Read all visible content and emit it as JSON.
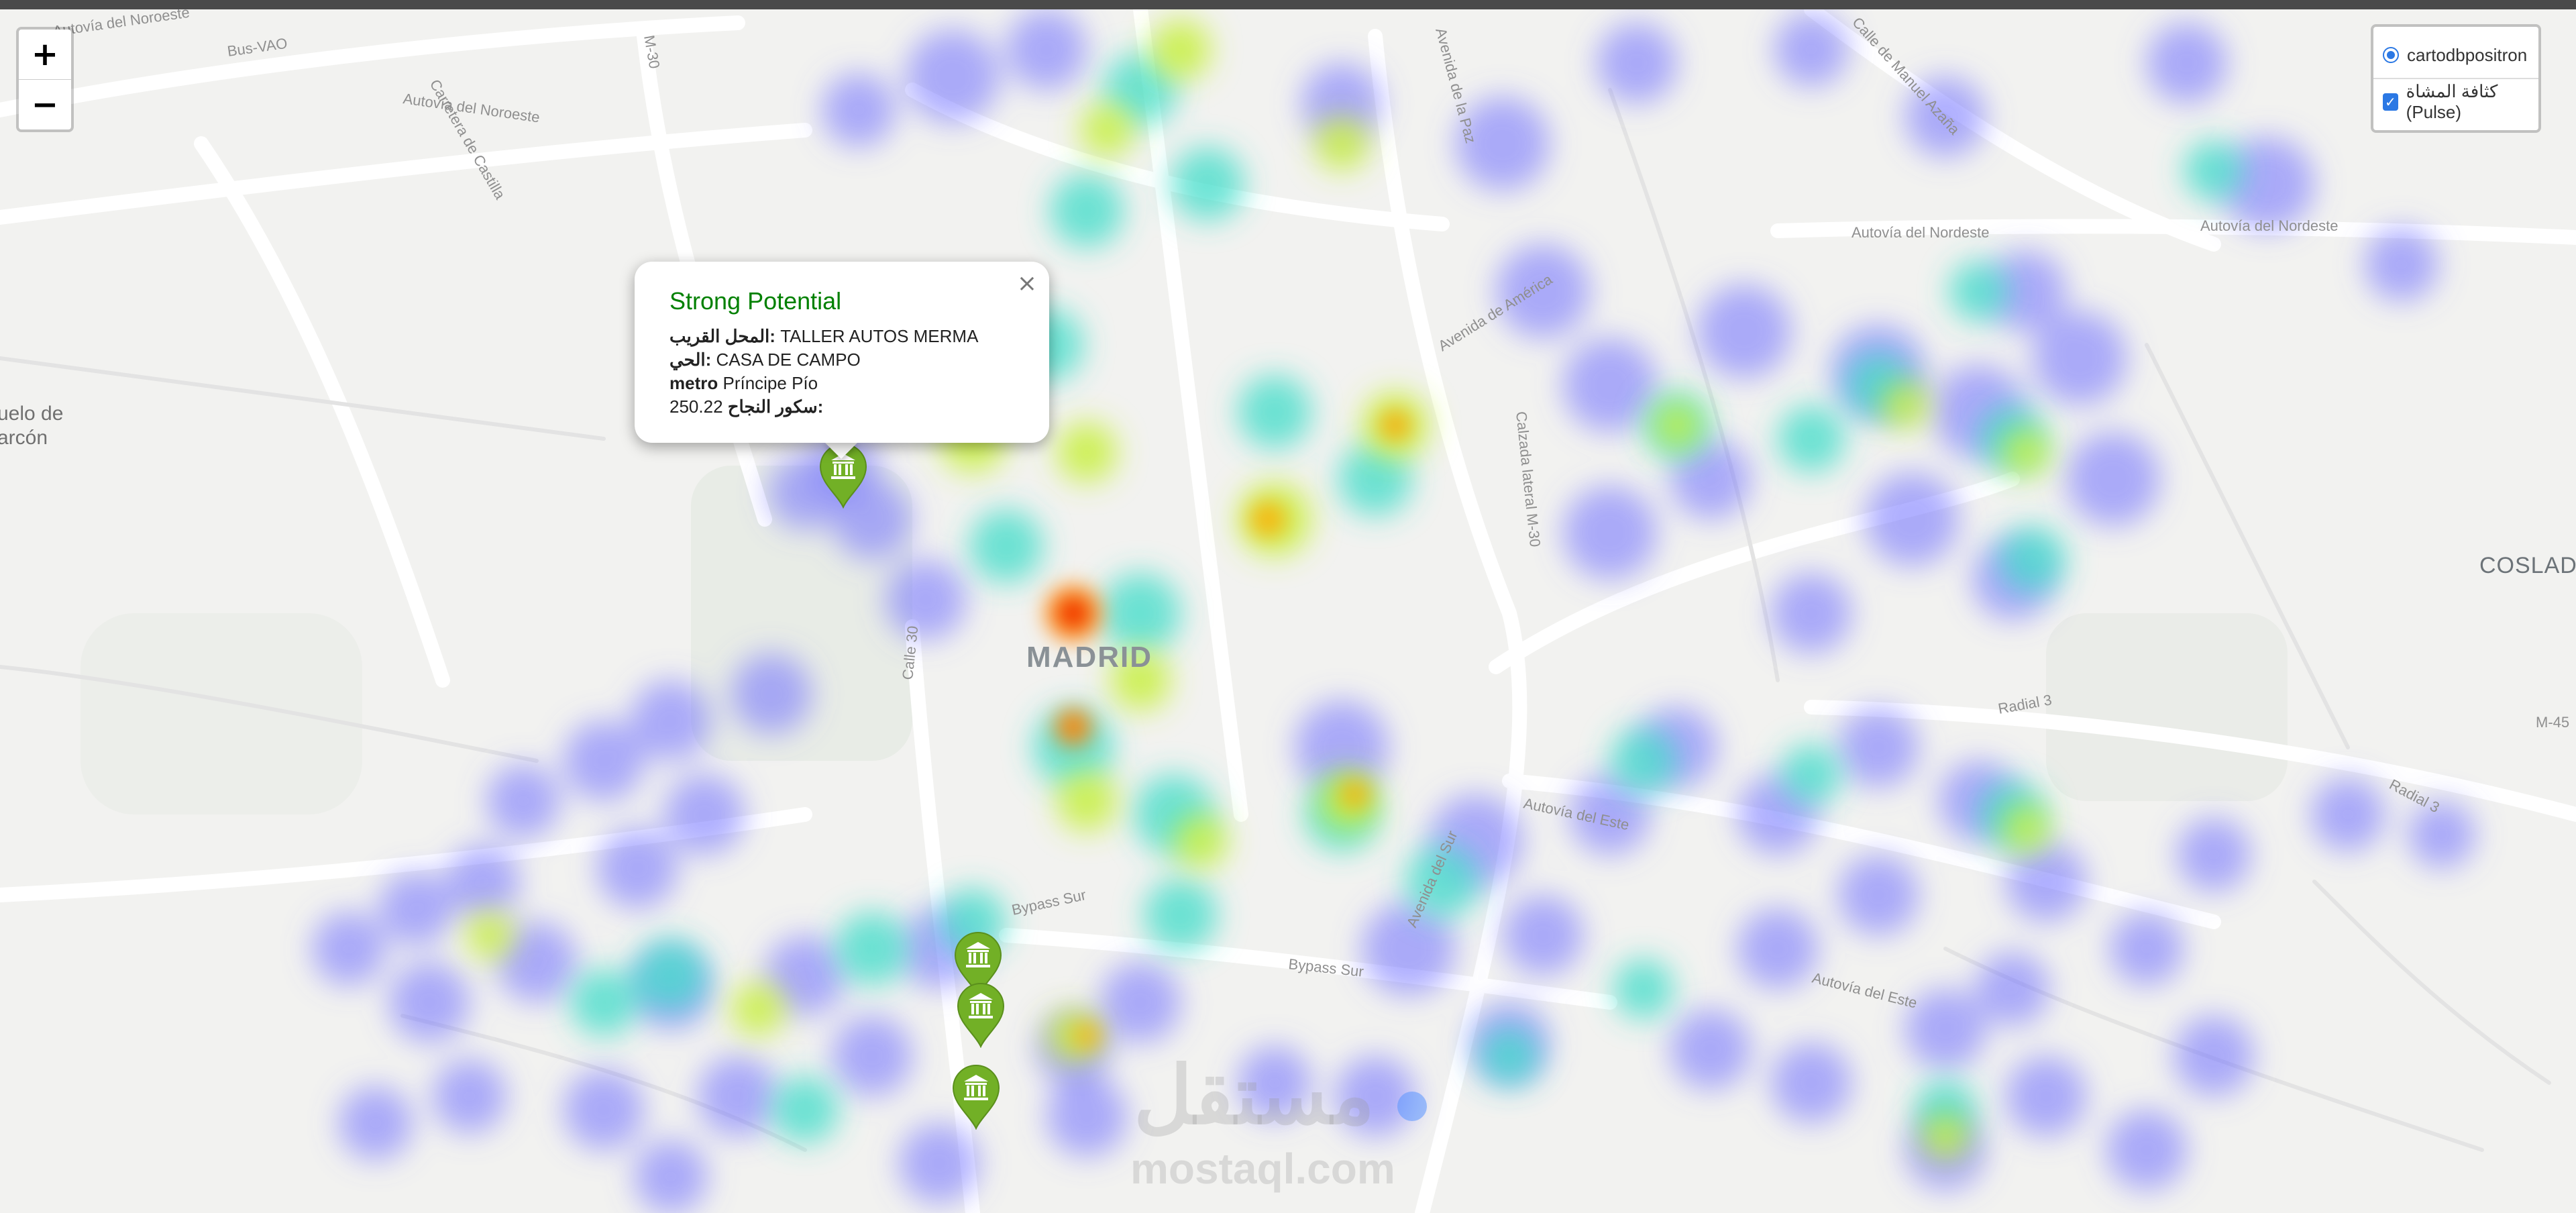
{
  "zoom": {
    "in_label": "+",
    "out_label": "−"
  },
  "layers": {
    "base": "cartodbpositron",
    "overlay": "كثافة المشاة (Pulse)"
  },
  "popup": {
    "close": "×",
    "title": "Strong Potential",
    "shop_label": "المحل القريب:",
    "shop_value": " TALLER AUTOS MERMA",
    "district_label": "الحي:",
    "district_value": " CASA DE CAMPO",
    "metro_label": "metro",
    "metro_value": " Príncipe Pío",
    "score_label": "سكور النجاح:",
    "score_value": "250.22"
  },
  "map_labels": {
    "city": "MADRID",
    "east_town": "COSLAD",
    "west_town_1": "uelo de",
    "west_town_2": "arcón",
    "streets": [
      "Autovía del Noroeste",
      "Bus-VAO",
      "Carretera de Castilla",
      "Autovía del Noroeste",
      "M-30",
      "Avenida de la Paz",
      "Calle de Manuel Azaña",
      "Autovía del Nordeste",
      "Autovía del Nordeste",
      "Avenida de América",
      "Calzada lateral M-30",
      "Calle 30",
      "Radial 3",
      "Radial 3",
      "M-45",
      "Autovía del Este",
      "Autovía del Este",
      "Bypass Sur",
      "Bypass Sur",
      "Avenida del Sur"
    ]
  },
  "watermark": {
    "arabic": "مستقل",
    "latin": "mostaql.com"
  },
  "markers": [
    {
      "icon": "museum-icon",
      "color": "#72b026"
    },
    {
      "icon": "museum-icon",
      "color": "#72b026"
    },
    {
      "icon": "museum-icon",
      "color": "#72b026"
    },
    {
      "icon": "museum-icon",
      "color": "#72b026"
    }
  ]
}
